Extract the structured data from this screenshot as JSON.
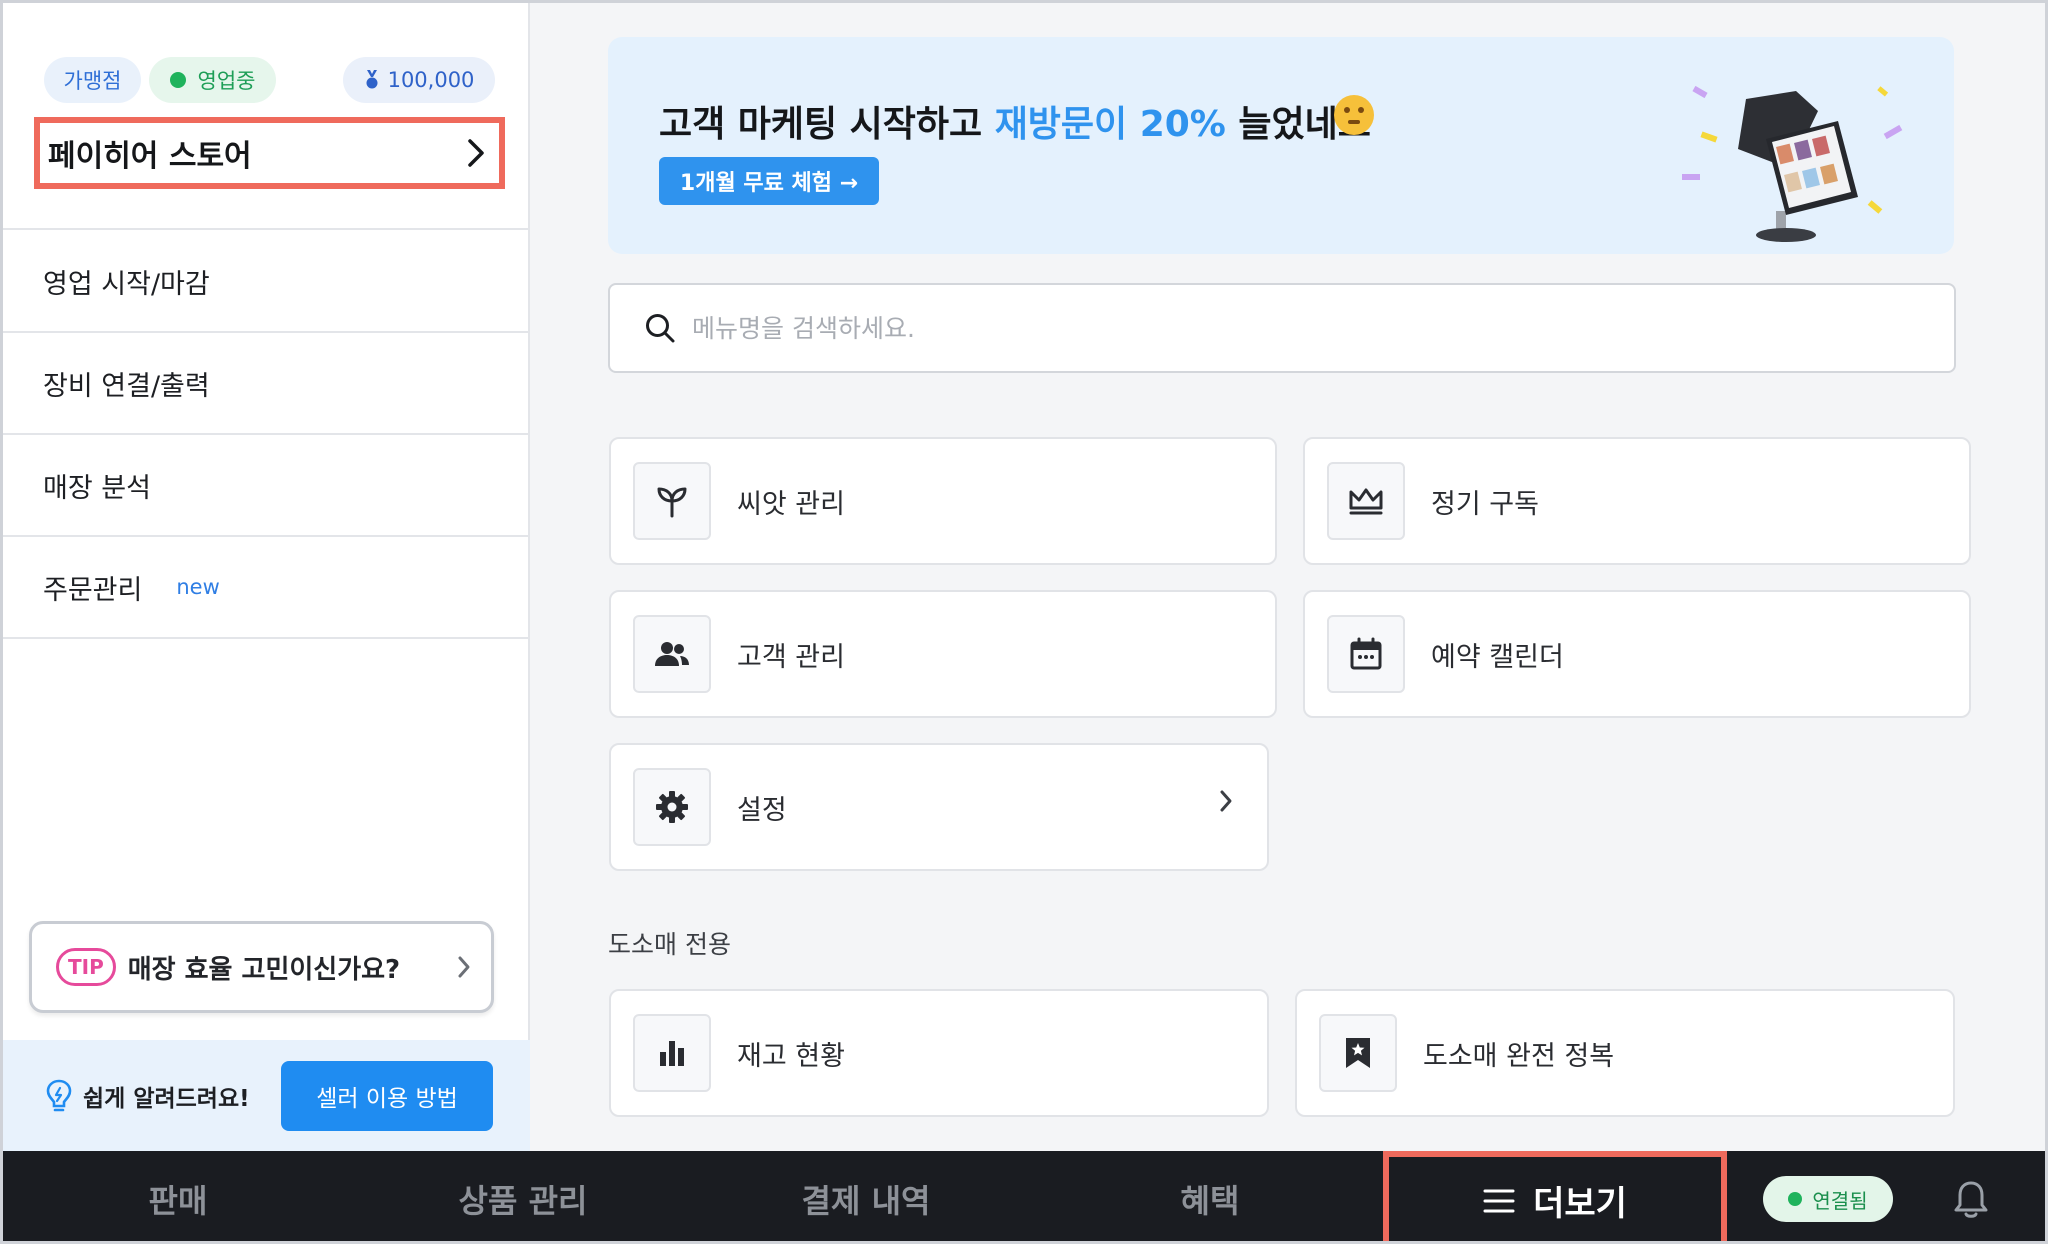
{
  "sidebar": {
    "chip_franchise": "가맹점",
    "chip_open": "영업중",
    "chip_points": "100,000",
    "store_name": "페이히어 스토어",
    "items": [
      {
        "label": "영업 시작/마감"
      },
      {
        "label": "장비 연결/출력"
      },
      {
        "label": "매장 분석"
      },
      {
        "label": "주문관리",
        "badge": "new"
      }
    ],
    "tip_badge": "TIP",
    "tip_text": "매장 효율 고민이신가요?",
    "help_text": "쉽게 알려드려요!",
    "seller_button": "셀러 이용 방법"
  },
  "banner": {
    "title_prefix": "고객 마케팅 시작하고 ",
    "title_highlight": "재방문이 20%",
    "title_suffix": " 늘었네요",
    "cta": "1개월 무료 체험 →"
  },
  "search": {
    "placeholder": "메뉴명을 검색하세요."
  },
  "menu": {
    "seed": "씨앗 관리",
    "subscription": "정기 구독",
    "customer": "고객 관리",
    "reservation": "예약 캘린더",
    "settings": "설정"
  },
  "wholesale": {
    "section_label": "도소매 전용",
    "stock": "재고 현황",
    "conquest": "도소매 완전 정복"
  },
  "bottom_nav": {
    "sales": "판매",
    "products": "상품 관리",
    "payments": "결제 내역",
    "benefits": "혜택",
    "more": "더보기",
    "connection": "연결됨"
  },
  "colors": {
    "accent_blue": "#2f93ee",
    "highlight_border": "#ef6a5c",
    "nav_background": "#1a1c21",
    "status_green": "#1fb35c"
  }
}
